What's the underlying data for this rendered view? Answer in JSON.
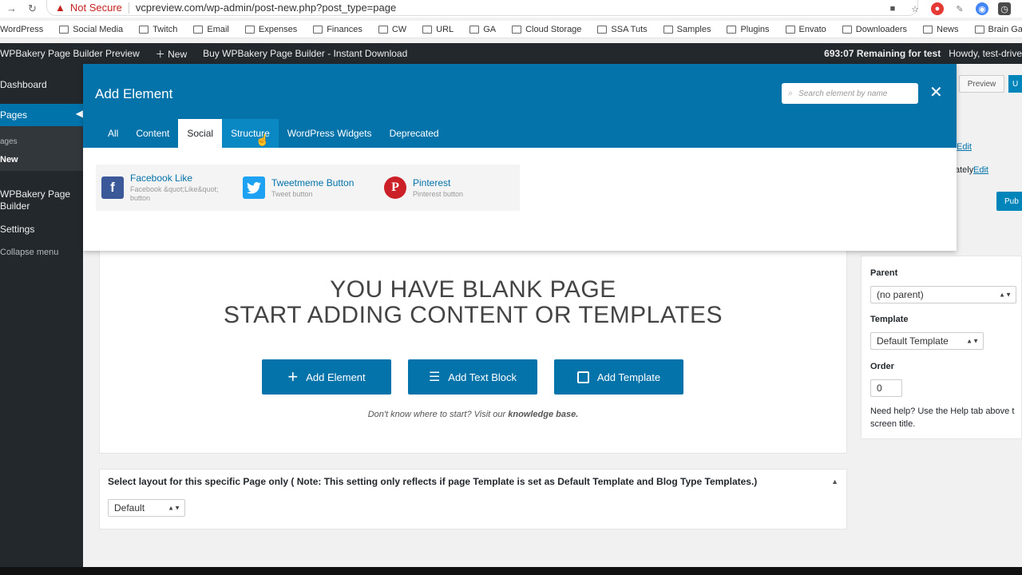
{
  "browser": {
    "warning": "Not Secure",
    "url": "vcpreview.com/wp-admin/post-new.php?post_type=page",
    "bookmarks": [
      "WordPress",
      "Social Media",
      "Twitch",
      "Email",
      "Expenses",
      "Finances",
      "CW",
      "URL",
      "GA",
      "Cloud Storage",
      "SSA Tuts",
      "Samples",
      "Plugins",
      "Envato",
      "Downloaders",
      "News",
      "Brain Games"
    ]
  },
  "adminbar": {
    "site": "WPBakery Page Builder Preview",
    "new": "New",
    "buy": "Buy WPBakery Page Builder - Instant Download",
    "remaining": "693:07 Remaining for test",
    "howdy": "Howdy, test-drive"
  },
  "sidebar": {
    "dashboard": "Dashboard",
    "pages": "Pages",
    "sub_pages": "ages",
    "sub_new": "New",
    "wpbakery": "WPBakery Page Builder",
    "settings": "Settings",
    "collapse": "Collapse menu"
  },
  "modal": {
    "title": "Add Element",
    "search_placeholder": "Search element by name",
    "tabs": [
      "All",
      "Content",
      "Social",
      "Structure",
      "WordPress Widgets",
      "Deprecated"
    ],
    "elements": [
      {
        "name": "Facebook Like",
        "desc": "Facebook &quot;Like&quot; button",
        "icon": "facebook-icon",
        "color": "#3b5998"
      },
      {
        "name": "Tweetmeme Button",
        "desc": "Tweet button",
        "icon": "twitter-icon",
        "color": "#1da1f2"
      },
      {
        "name": "Pinterest",
        "desc": "Pinterest button",
        "icon": "pinterest-icon",
        "color": "#cb2027"
      }
    ]
  },
  "editor": {
    "blank_line1": "YOU HAVE BLANK PAGE",
    "blank_line2": "START ADDING CONTENT OR TEMPLATES",
    "add_element": "Add Element",
    "add_text_block": "Add Text Block",
    "add_template": "Add Template",
    "hint_prefix": "Don't know where to start? Visit our",
    "hint_link": "knowledge base."
  },
  "layout": {
    "label": "Select layout for this specific Page only ( Note: This setting only reflects if page Template is set as Default Template and Blog Type Templates.)",
    "value": "Default"
  },
  "attributes": {
    "preview": "Preview",
    "publish_edge": "Pub",
    "update_edge": "U",
    "edit1": "Edit",
    "ately": "ately",
    "edit2": "Edit",
    "parent_label": "Parent",
    "parent_value": "(no parent)",
    "template_label": "Template",
    "template_value": "Default Template",
    "order_label": "Order",
    "order_value": "0",
    "help": "Need help? Use the Help tab above t screen title."
  },
  "colors": {
    "wp_blue": "#0473aa",
    "admin_dark": "#23282d"
  }
}
